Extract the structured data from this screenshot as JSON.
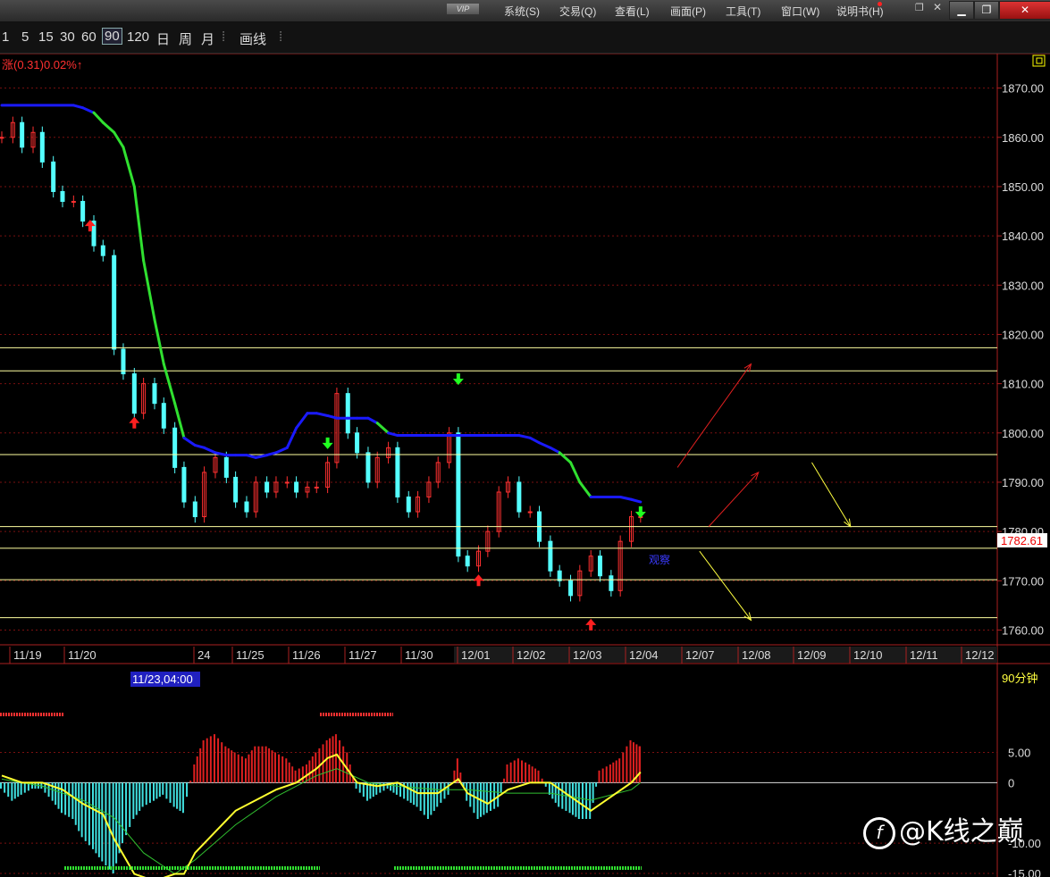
{
  "menubar": {
    "vip": "VIP",
    "items": [
      "系统(S)",
      "交易(Q)",
      "查看(L)",
      "画面(P)",
      "工具(T)",
      "窗口(W)",
      "说明书(H)"
    ]
  },
  "toolbar": {
    "periods": [
      "1",
      "5",
      "15",
      "30",
      "60",
      "90",
      "120",
      "日",
      "周",
      "月",
      "画线"
    ],
    "active": "90"
  },
  "chart_data": {
    "type": "candlestick",
    "price_change": "涨(0.31)0.02%↑",
    "ylim": [
      1757,
      1877
    ],
    "y_ticks": [
      1870,
      1860,
      1850,
      1840,
      1830,
      1820,
      1810,
      1800,
      1790,
      1780,
      1770,
      1760
    ],
    "current_price": "1782.61",
    "period_label": "90分钟",
    "crosshair_label": "11/23,04:00",
    "annotation": "观察",
    "x_dates": [
      "11/19",
      "11/20",
      "11/23",
      "11/24",
      "11/25",
      "11/26",
      "11/27",
      "11/30",
      "12/01",
      "12/02",
      "12/03",
      "12/04",
      "12/07",
      "12/08",
      "12/09",
      "12/10",
      "12/11",
      "12/12"
    ],
    "x_date_labels": [
      "11/19",
      "11/20",
      "24",
      "11/25",
      "11/26",
      "11/27",
      "11/30",
      "12/01",
      "12/02",
      "12/03",
      "12/04",
      "12/07",
      "12/08",
      "12/09",
      "12/10",
      "12/11",
      "12/12"
    ],
    "close_path": [
      [
        0,
        1860
      ],
      [
        6,
        1863
      ],
      [
        11,
        1858
      ],
      [
        17,
        1861
      ],
      [
        22,
        1855
      ],
      [
        28,
        1849
      ],
      [
        33,
        1847
      ],
      [
        39,
        1847
      ],
      [
        44,
        1843
      ],
      [
        50,
        1838
      ],
      [
        55,
        1836
      ],
      [
        61,
        1817
      ],
      [
        66,
        1812
      ],
      [
        72,
        1804
      ],
      [
        77,
        1810
      ],
      [
        83,
        1806
      ],
      [
        88,
        1801
      ],
      [
        94,
        1793
      ],
      [
        99,
        1786
      ],
      [
        105,
        1783
      ],
      [
        110,
        1792
      ],
      [
        116,
        1795
      ],
      [
        122,
        1791
      ],
      [
        127,
        1786
      ],
      [
        133,
        1784
      ],
      [
        138,
        1790
      ],
      [
        144,
        1788
      ],
      [
        149,
        1790
      ],
      [
        155,
        1790
      ],
      [
        160,
        1788
      ],
      [
        166,
        1789
      ],
      [
        171,
        1789
      ],
      [
        177,
        1794
      ],
      [
        182,
        1808
      ],
      [
        188,
        1800
      ],
      [
        193,
        1796
      ],
      [
        199,
        1790
      ],
      [
        204,
        1795
      ],
      [
        210,
        1797
      ],
      [
        215,
        1787
      ],
      [
        221,
        1784
      ],
      [
        226,
        1787
      ],
      [
        232,
        1790
      ],
      [
        237,
        1794
      ],
      [
        243,
        1800
      ],
      [
        248,
        1775
      ],
      [
        253,
        1773
      ],
      [
        259,
        1776
      ],
      [
        264,
        1780
      ],
      [
        270,
        1788
      ],
      [
        275,
        1790
      ],
      [
        281,
        1784
      ],
      [
        287,
        1784
      ],
      [
        292,
        1778
      ],
      [
        298,
        1772
      ],
      [
        303,
        1770
      ],
      [
        309,
        1767
      ],
      [
        314,
        1772
      ],
      [
        320,
        1775
      ],
      [
        325,
        1771
      ],
      [
        331,
        1768
      ],
      [
        336,
        1778
      ],
      [
        342,
        1783
      ],
      [
        347,
        1783
      ]
    ],
    "ma_blue": [
      [
        0,
        1866.5
      ],
      [
        39,
        1866.5
      ],
      [
        44,
        1866
      ],
      [
        50,
        1865
      ],
      [
        55,
        1863
      ],
      [
        61,
        1861
      ],
      [
        66,
        1858
      ],
      [
        72,
        1850
      ],
      [
        77,
        1835
      ],
      [
        83,
        1823
      ],
      [
        88,
        1814
      ],
      [
        94,
        1806
      ],
      [
        99,
        1799
      ],
      [
        105,
        1797.5
      ],
      [
        110,
        1797
      ],
      [
        116,
        1796
      ],
      [
        122,
        1795.5
      ],
      [
        127,
        1795.5
      ],
      [
        133,
        1795.5
      ],
      [
        138,
        1795
      ],
      [
        144,
        1795.5
      ],
      [
        149,
        1796
      ],
      [
        155,
        1797
      ],
      [
        160,
        1801
      ],
      [
        166,
        1804
      ],
      [
        171,
        1804
      ],
      [
        177,
        1803.5
      ],
      [
        182,
        1803
      ],
      [
        188,
        1803
      ],
      [
        193,
        1803
      ],
      [
        199,
        1803
      ],
      [
        204,
        1802
      ],
      [
        210,
        1800
      ],
      [
        215,
        1799.5
      ],
      [
        221,
        1799.5
      ],
      [
        226,
        1799.5
      ],
      [
        232,
        1799.5
      ],
      [
        237,
        1799.5
      ],
      [
        243,
        1799.5
      ],
      [
        248,
        1799.5
      ],
      [
        253,
        1799.5
      ],
      [
        259,
        1799.5
      ],
      [
        264,
        1799.5
      ],
      [
        270,
        1799.5
      ],
      [
        275,
        1799.5
      ],
      [
        281,
        1799.5
      ],
      [
        287,
        1799
      ],
      [
        292,
        1798
      ],
      [
        298,
        1797
      ],
      [
        303,
        1796
      ],
      [
        309,
        1794
      ],
      [
        314,
        1790
      ],
      [
        320,
        1787
      ],
      [
        325,
        1787
      ],
      [
        331,
        1787
      ],
      [
        336,
        1787
      ],
      [
        342,
        1786.5
      ],
      [
        347,
        1786
      ]
    ],
    "h_lines": [
      {
        "y": 1817.3,
        "color": "#ffffa0"
      },
      {
        "y": 1812.6,
        "color": "#ffffa0"
      },
      {
        "y": 1795.6,
        "color": "#ffffa0"
      },
      {
        "y": 1781.0,
        "color": "#ffffa0"
      },
      {
        "y": 1776.6,
        "color": "#ffffa0"
      },
      {
        "y": 1770.2,
        "color": "#ffffa0"
      },
      {
        "y": 1762.5,
        "color": "#ffffa0"
      }
    ],
    "projection_arrows": [
      {
        "from": [
          368,
          1793
        ],
        "to": [
          408,
          1814
        ],
        "color": "#e02020"
      },
      {
        "from": [
          385,
          1781
        ],
        "to": [
          412,
          1792
        ],
        "color": "#e02020"
      },
      {
        "from": [
          380,
          1776
        ],
        "to": [
          408,
          1762
        ],
        "color": "#ffff40"
      },
      {
        "from": [
          441,
          1794
        ],
        "to": [
          462,
          1781
        ],
        "color": "#ffff40"
      }
    ],
    "signals": [
      {
        "x": 48,
        "y": 1842,
        "dir": "up"
      },
      {
        "x": 72,
        "y": 1802,
        "dir": "up"
      },
      {
        "x": 177,
        "y": 1798,
        "dir": "down"
      },
      {
        "x": 248,
        "y": 1811,
        "dir": "down"
      },
      {
        "x": 259,
        "y": 1770,
        "dir": "up"
      },
      {
        "x": 320,
        "y": 1761,
        "dir": "up"
      },
      {
        "x": 347,
        "y": 1784,
        "dir": "down"
      }
    ],
    "indicator": {
      "y_ticks": [
        "5.00",
        "0",
        "-10.00",
        "-15.00"
      ],
      "ylim": [
        -15,
        12
      ],
      "hist": [
        [
          0,
          -1
        ],
        [
          6,
          -3
        ],
        [
          11,
          -2
        ],
        [
          17,
          -1
        ],
        [
          22,
          -1
        ],
        [
          28,
          -3
        ],
        [
          33,
          -5
        ],
        [
          39,
          -6
        ],
        [
          44,
          -9
        ],
        [
          50,
          -11
        ],
        [
          55,
          -13
        ],
        [
          61,
          -15
        ],
        [
          66,
          -10
        ],
        [
          72,
          -6
        ],
        [
          77,
          -4
        ],
        [
          83,
          -3
        ],
        [
          88,
          -2
        ],
        [
          94,
          -4
        ],
        [
          99,
          -5
        ],
        [
          105,
          3
        ],
        [
          110,
          7
        ],
        [
          116,
          8
        ],
        [
          122,
          6
        ],
        [
          127,
          5
        ],
        [
          133,
          4
        ],
        [
          138,
          6
        ],
        [
          144,
          6
        ],
        [
          149,
          5
        ],
        [
          155,
          4
        ],
        [
          160,
          2
        ],
        [
          166,
          3
        ],
        [
          171,
          5
        ],
        [
          177,
          7
        ],
        [
          182,
          8
        ],
        [
          188,
          5
        ],
        [
          193,
          -1
        ],
        [
          199,
          -3
        ],
        [
          204,
          -2
        ],
        [
          210,
          -1
        ],
        [
          215,
          -2
        ],
        [
          221,
          -3
        ],
        [
          226,
          -4
        ],
        [
          232,
          -6
        ],
        [
          237,
          -4
        ],
        [
          243,
          -2
        ],
        [
          248,
          4
        ],
        [
          253,
          -3
        ],
        [
          259,
          -6
        ],
        [
          264,
          -5
        ],
        [
          270,
          -4
        ],
        [
          275,
          3
        ],
        [
          281,
          4
        ],
        [
          287,
          3
        ],
        [
          292,
          2
        ],
        [
          298,
          -2
        ],
        [
          303,
          -4
        ],
        [
          309,
          -5
        ],
        [
          314,
          -6
        ],
        [
          320,
          -6
        ],
        [
          325,
          2
        ],
        [
          331,
          3
        ],
        [
          336,
          4
        ],
        [
          342,
          7
        ],
        [
          347,
          6
        ]
      ],
      "yellow_line": [
        [
          0,
          2
        ],
        [
          11,
          0
        ],
        [
          22,
          0
        ],
        [
          33,
          -2
        ],
        [
          44,
          -6
        ],
        [
          55,
          -9
        ],
        [
          61,
          -16
        ],
        [
          72,
          -26
        ],
        [
          83,
          -28
        ],
        [
          94,
          -26
        ],
        [
          99,
          -26
        ],
        [
          105,
          -20
        ],
        [
          116,
          -14
        ],
        [
          127,
          -8
        ],
        [
          138,
          -5
        ],
        [
          149,
          -2
        ],
        [
          160,
          0
        ],
        [
          171,
          4
        ],
        [
          177,
          7
        ],
        [
          182,
          8
        ],
        [
          193,
          0
        ],
        [
          204,
          -1
        ],
        [
          215,
          0
        ],
        [
          226,
          -3
        ],
        [
          237,
          -3
        ],
        [
          248,
          1
        ],
        [
          253,
          -3
        ],
        [
          264,
          -6
        ],
        [
          275,
          -2
        ],
        [
          287,
          0
        ],
        [
          298,
          0
        ],
        [
          309,
          -4
        ],
        [
          320,
          -8
        ],
        [
          331,
          -4
        ],
        [
          342,
          0
        ],
        [
          347,
          3
        ]
      ],
      "green_line": [
        [
          0,
          1
        ],
        [
          22,
          -1
        ],
        [
          44,
          -5
        ],
        [
          61,
          -10
        ],
        [
          77,
          -20
        ],
        [
          94,
          -26
        ],
        [
          105,
          -22
        ],
        [
          127,
          -12
        ],
        [
          149,
          -4
        ],
        [
          171,
          2
        ],
        [
          182,
          4
        ],
        [
          199,
          0
        ],
        [
          215,
          -1
        ],
        [
          237,
          -2
        ],
        [
          253,
          -2
        ],
        [
          275,
          -3
        ],
        [
          298,
          -3
        ],
        [
          320,
          -5
        ],
        [
          342,
          -2
        ],
        [
          347,
          0
        ]
      ]
    }
  },
  "watermark": "@K线之巅"
}
